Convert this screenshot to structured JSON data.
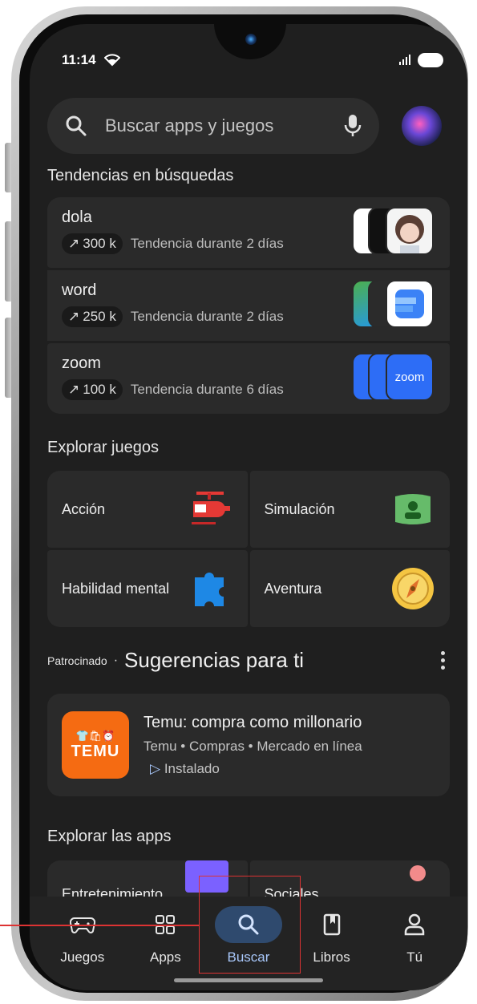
{
  "status": {
    "time": "11:14"
  },
  "search": {
    "placeholder": "Buscar apps y juegos"
  },
  "trending": {
    "title": "Tendencias en búsquedas",
    "items": [
      {
        "name": "dola",
        "count": "300 k",
        "desc": "Tendencia durante 2 días"
      },
      {
        "name": "word",
        "count": "250 k",
        "desc": "Tendencia durante 2 días"
      },
      {
        "name": "zoom",
        "count": "100 k",
        "desc": "Tendencia durante 6 días"
      }
    ]
  },
  "zoom_icon_text": "zoom",
  "games": {
    "title": "Explorar juegos",
    "categories": [
      {
        "label": "Acción",
        "icon": "helicopter-icon"
      },
      {
        "label": "Simulación",
        "icon": "simulation-icon"
      },
      {
        "label": "Habilidad mental",
        "icon": "puzzle-icon"
      },
      {
        "label": "Aventura",
        "icon": "compass-icon"
      }
    ]
  },
  "sponsored": {
    "label": "Patrocinado",
    "title": "Sugerencias para ti",
    "app": {
      "name": "Temu: compra como millonario",
      "developer": "Temu",
      "category": "Compras",
      "tag": "Mercado en línea",
      "status": "Instalado",
      "logo_text": "TEMU"
    }
  },
  "apps": {
    "title": "Explorar las apps",
    "categories": [
      {
        "label": "Entretenimiento"
      },
      {
        "label": "Sociales"
      }
    ]
  },
  "nav": {
    "items": [
      {
        "label": "Juegos",
        "icon": "gamepad-icon"
      },
      {
        "label": "Apps",
        "icon": "apps-grid-icon"
      },
      {
        "label": "Buscar",
        "icon": "search-icon",
        "active": true
      },
      {
        "label": "Libros",
        "icon": "book-icon"
      },
      {
        "label": "Tú",
        "icon": "person-icon"
      }
    ]
  },
  "colors": {
    "background": "#1f1f1f",
    "card": "#2a2a2a",
    "accent": "#a8c7fa",
    "active_pill": "#2f4a6e",
    "temu": "#f56b12",
    "annotation": "#dd3333"
  }
}
